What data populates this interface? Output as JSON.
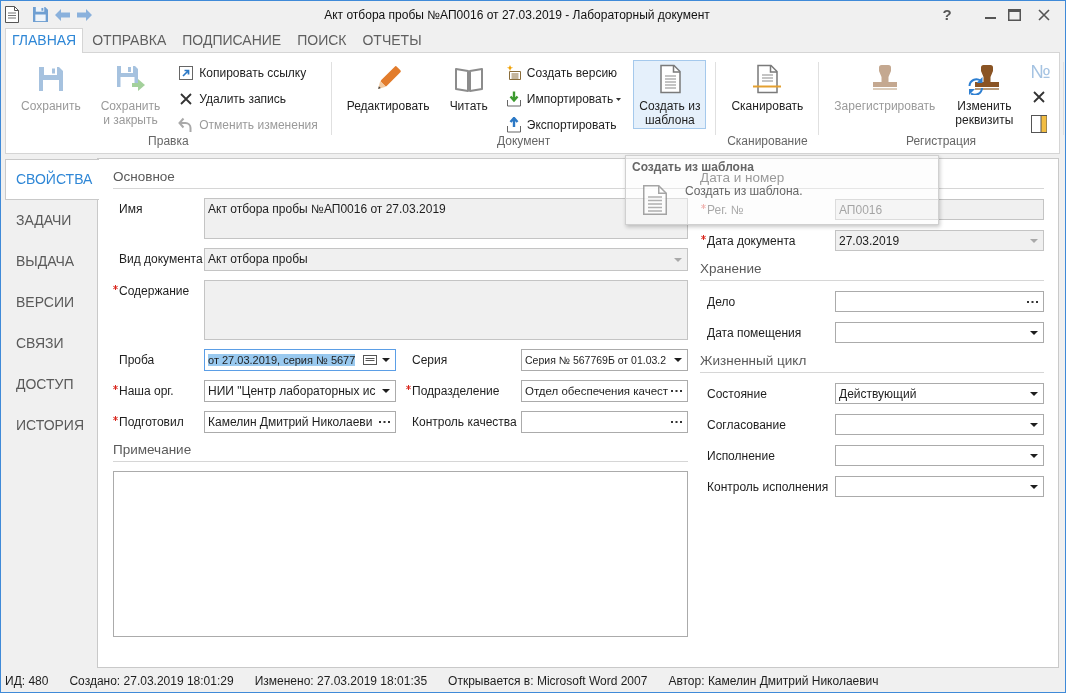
{
  "window": {
    "title": "Акт отбора пробы №АП0016 от 27.03.2019 - Лабораторный документ",
    "help_button": "?"
  },
  "ribbon": {
    "tabs": [
      {
        "label": "ГЛАВНАЯ",
        "selected": true
      },
      {
        "label": "ОТПРАВКА",
        "selected": false
      },
      {
        "label": "ПОДПИСАНИЕ",
        "selected": false
      },
      {
        "label": "ПОИСК",
        "selected": false
      },
      {
        "label": "ОТЧЕТЫ",
        "selected": false
      }
    ],
    "groups": [
      {
        "label": "Правка",
        "items": [
          {
            "kind": "large",
            "label": "Сохранить",
            "disabled": true,
            "hovered": false,
            "menu": false
          },
          {
            "kind": "large",
            "label": "Сохранить\nи закрыть",
            "disabled": true,
            "hovered": false,
            "menu": false
          },
          {
            "kind": "small",
            "label": "Копировать ссылку",
            "disabled": false,
            "hovered": false,
            "menu": false
          },
          {
            "kind": "small",
            "label": "Удалить запись",
            "disabled": false,
            "hovered": false,
            "menu": false
          },
          {
            "kind": "small",
            "label": "Отменить изменения",
            "disabled": true,
            "hovered": false,
            "menu": false
          }
        ]
      },
      {
        "label": "Документ",
        "items": [
          {
            "kind": "large",
            "label": "Редактировать",
            "disabled": false,
            "hovered": false,
            "menu": false
          },
          {
            "kind": "large",
            "label": "Читать",
            "disabled": false,
            "hovered": false,
            "menu": false
          },
          {
            "kind": "small",
            "label": "Создать версию",
            "disabled": false,
            "hovered": false,
            "menu": false
          },
          {
            "kind": "small",
            "label": "Импортировать",
            "disabled": false,
            "hovered": false,
            "menu": true
          },
          {
            "kind": "small",
            "label": "Экспортировать",
            "disabled": false,
            "hovered": false,
            "menu": false
          },
          {
            "kind": "large",
            "label": "Создать из\nшаблона",
            "disabled": false,
            "hovered": true,
            "menu": false
          }
        ]
      },
      {
        "label": "Сканирование",
        "items": [
          {
            "kind": "large",
            "label": "Сканировать",
            "disabled": false,
            "hovered": false,
            "menu": false
          }
        ]
      },
      {
        "label": "Регистрация",
        "items": [
          {
            "kind": "large",
            "label": "Зарегистрировать",
            "disabled": true,
            "hovered": false,
            "menu": false
          },
          {
            "kind": "large",
            "label": "Изменить\nреквизиты",
            "disabled": false,
            "hovered": false,
            "menu": false
          },
          {
            "kind": "glyph",
            "label": "№",
            "disabled": true,
            "hovered": false
          },
          {
            "kind": "icon",
            "disabled": false,
            "hovered": false
          },
          {
            "kind": "icon",
            "disabled": false,
            "hovered": false
          }
        ]
      }
    ]
  },
  "tooltip": {
    "title": "Создать из шаблона",
    "text": "Создать из шаблона."
  },
  "navigation": {
    "items": [
      {
        "label": "СВОЙСТВА",
        "selected": true
      },
      {
        "label": "ЗАДАЧИ",
        "selected": false
      },
      {
        "label": "ВЫДАЧА",
        "selected": false
      },
      {
        "label": "ВЕРСИИ",
        "selected": false
      },
      {
        "label": "СВЯЗИ",
        "selected": false
      },
      {
        "label": "ДОСТУП",
        "selected": false
      },
      {
        "label": "ИСТОРИЯ",
        "selected": false
      }
    ]
  },
  "form": {
    "columns": [
      {
        "sections": [
          {
            "kind": "fields",
            "title": "Основное",
            "rows": [
              {
                "fields": [
                  {
                    "label": "Имя",
                    "required": false,
                    "kind": "memo",
                    "value": "Акт отбора пробы №АП0016 от 27.03.2019",
                    "readonly": true,
                    "disabled": false,
                    "focused": false
                  }
                ]
              },
              {
                "fields": [
                  {
                    "label": "Вид документа",
                    "required": false,
                    "kind": "combo",
                    "value": "Акт отбора пробы",
                    "readonly": true,
                    "disabled": false,
                    "focused": false
                  }
                ]
              },
              {
                "fields": [
                  {
                    "label": "Содержание",
                    "required": true,
                    "kind": "textarea",
                    "readonly": true,
                    "disabled": false,
                    "focused": false
                  }
                ]
              },
              {
                "fields": [
                  {
                    "label": "Проба",
                    "required": false,
                    "kind": "picker",
                    "value": "от 27.03.2019, серия № 5677",
                    "readonly": false,
                    "disabled": false,
                    "focused": true
                  },
                  {
                    "label": "Серия",
                    "required": false,
                    "kind": "combo",
                    "value": "Серия № 567769Б от 01.03.2",
                    "readonly": false,
                    "disabled": false,
                    "focused": false
                  }
                ]
              },
              {
                "fields": [
                  {
                    "label": "Наша орг.",
                    "required": true,
                    "kind": "combo",
                    "value": "НИИ \"Центр лабораторных ис",
                    "readonly": false,
                    "disabled": false,
                    "focused": false
                  },
                  {
                    "label": "Подразделение",
                    "required": true,
                    "kind": "lookup",
                    "value": "Отдел обеспечения качест",
                    "readonly": false,
                    "disabled": false,
                    "focused": false
                  }
                ]
              },
              {
                "fields": [
                  {
                    "label": "Подготовил",
                    "required": true,
                    "kind": "lookup",
                    "value": "Камелин Дмитрий Николаеви",
                    "readonly": false,
                    "disabled": false,
                    "focused": false
                  },
                  {
                    "label": "Контроль качества",
                    "required": false,
                    "kind": "lookup",
                    "readonly": false,
                    "disabled": false,
                    "focused": false
                  }
                ]
              }
            ]
          },
          {
            "kind": "notes",
            "title": "Примечание"
          }
        ]
      },
      {
        "sections": [
          {
            "kind": "fields",
            "title": "Дата и номер",
            "rows": [
              {
                "fields": [
                  {
                    "label": "Рег. №",
                    "required": true,
                    "kind": "text",
                    "value": "АП0016",
                    "readonly": true,
                    "disabled": true,
                    "focused": false
                  }
                ]
              },
              {
                "fields": [
                  {
                    "label": "Дата документа",
                    "required": true,
                    "kind": "combo",
                    "value": "27.03.2019",
                    "readonly": true,
                    "disabled": false,
                    "focused": false
                  }
                ]
              }
            ]
          },
          {
            "kind": "fields",
            "title": "Хранение",
            "rows": [
              {
                "fields": [
                  {
                    "label": "Дело",
                    "required": false,
                    "kind": "lookup",
                    "readonly": false,
                    "disabled": false,
                    "focused": false
                  }
                ]
              },
              {
                "fields": [
                  {
                    "label": "Дата помещения",
                    "required": false,
                    "kind": "combo",
                    "readonly": false,
                    "disabled": false,
                    "focused": false
                  }
                ]
              }
            ]
          },
          {
            "kind": "fields",
            "title": "Жизненный цикл",
            "rows": [
              {
                "fields": [
                  {
                    "label": "Состояние",
                    "required": false,
                    "kind": "combo",
                    "value": "Действующий",
                    "readonly": false,
                    "disabled": false,
                    "focused": false
                  }
                ]
              },
              {
                "fields": [
                  {
                    "label": "Согласование",
                    "required": false,
                    "kind": "combo",
                    "readonly": false,
                    "disabled": false,
                    "focused": false
                  }
                ]
              },
              {
                "fields": [
                  {
                    "label": "Исполнение",
                    "required": false,
                    "kind": "combo",
                    "readonly": false,
                    "disabled": false,
                    "focused": false
                  }
                ]
              },
              {
                "fields": [
                  {
                    "label": "Контроль исполнения",
                    "required": false,
                    "kind": "combo",
                    "readonly": false,
                    "disabled": false,
                    "focused": false
                  }
                ]
              }
            ]
          }
        ]
      }
    ]
  },
  "status_bar": {
    "items": [
      "ИД: 480",
      "Создано: 27.03.2019 18:01:29",
      "Изменено: 27.03.2019 18:01:35",
      "Открывается в: Microsoft Word 2007",
      "Автор: Камелин Дмитрий Николаевич"
    ]
  }
}
